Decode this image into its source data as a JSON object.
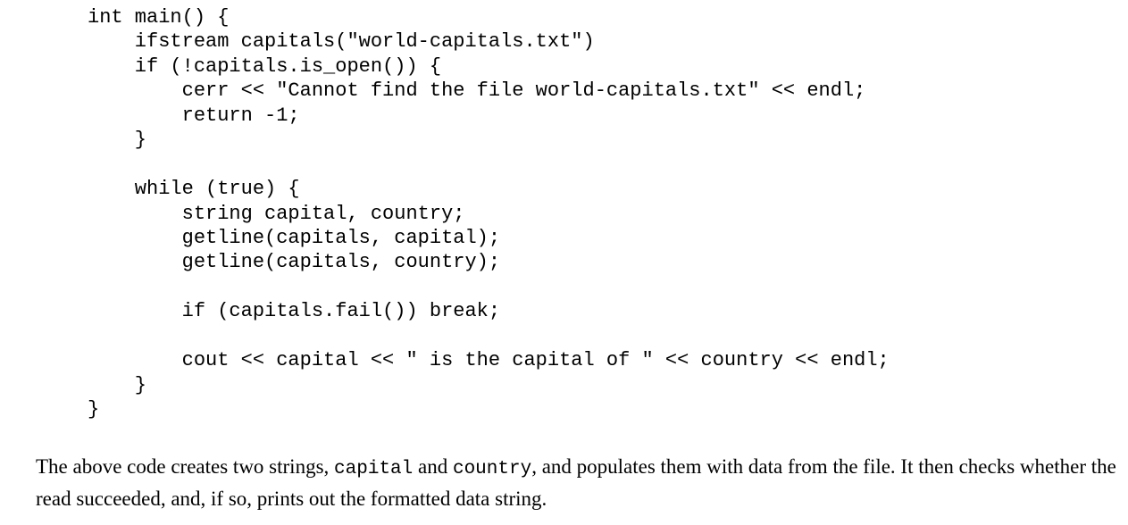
{
  "code": {
    "lines": [
      "int main() {",
      "    ifstream capitals(\"world-capitals.txt\")",
      "    if (!capitals.is_open()) {",
      "        cerr << \"Cannot find the file world-capitals.txt\" << endl;",
      "        return -1;",
      "    }",
      "",
      "    while (true) {",
      "        string capital, country;",
      "        getline(capitals, capital);",
      "        getline(capitals, country);",
      "",
      "        if (capitals.fail()) break;",
      "",
      "        cout << capital << \" is the capital of \" << country << endl;",
      "    }",
      "}"
    ]
  },
  "paragraph": {
    "text_1": "The above code creates two strings, ",
    "code_1": "capital",
    "text_2": " and ",
    "code_2": "country",
    "text_3": ", and populates them with data from the file.  It then checks whether the read succeeded, and, if so, prints out the formatted data string."
  }
}
